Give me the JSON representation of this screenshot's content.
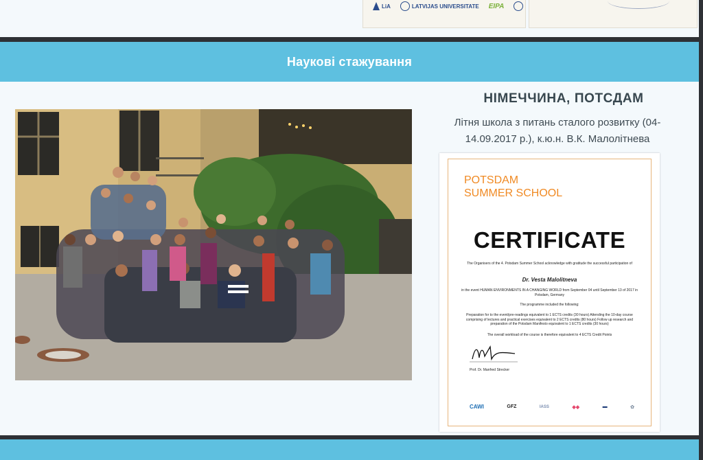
{
  "top_strip": {
    "logos": [
      "LiA",
      "LATVIJAS UNIVERSITATE",
      "EIPA"
    ]
  },
  "section": {
    "heading": "Наукові стажування",
    "location": "НІМЕЧЧИНА, ПОТСДАМ",
    "caption": "Літня школа з питань сталого розвитку (04-14.09.2017 р.), к.ю.н. В.К. Малолітнева"
  },
  "certificate": {
    "school_line1": "POTSDAM",
    "school_line2": "SUMMER SCHOOL",
    "title": "CERTIFICATE",
    "intro": "The Organisers of the 4. Potsdam Summer School acknowledge with gratitude the successful participation of",
    "name": "Dr. Vesta Malolitneva",
    "event": "in the event HUMAN ENVIRONMENTS IN A CHANGING WORLD from September 04 until September 13 of 2017 in Potsdam, Germany",
    "programme_intro": "The programme included the following:",
    "programme": "Preparation for to the event/pre-readings equivalent to 1 ECTS credits (30 hours) Attending the 10-day course comprising of lectures and practical exercises equivalent to 2 ECTS credits (80 hours) Follow up research and preparation of the Potsdam Manifesto equivalent to 1 ECTS credits (30 hours)",
    "workload": "The overall workload of the course is therefore equivalent to 4 ECTS Credit Points",
    "signer": "Prof. Dr. Manfred Strecker",
    "logos": [
      "CAWI",
      "GFZ",
      "IASS"
    ]
  },
  "colors": {
    "header_bg": "#5ec0e0",
    "panel_bg": "#f4f9fc",
    "frame": "#2e3135",
    "cert_accent": "#f08a24"
  }
}
